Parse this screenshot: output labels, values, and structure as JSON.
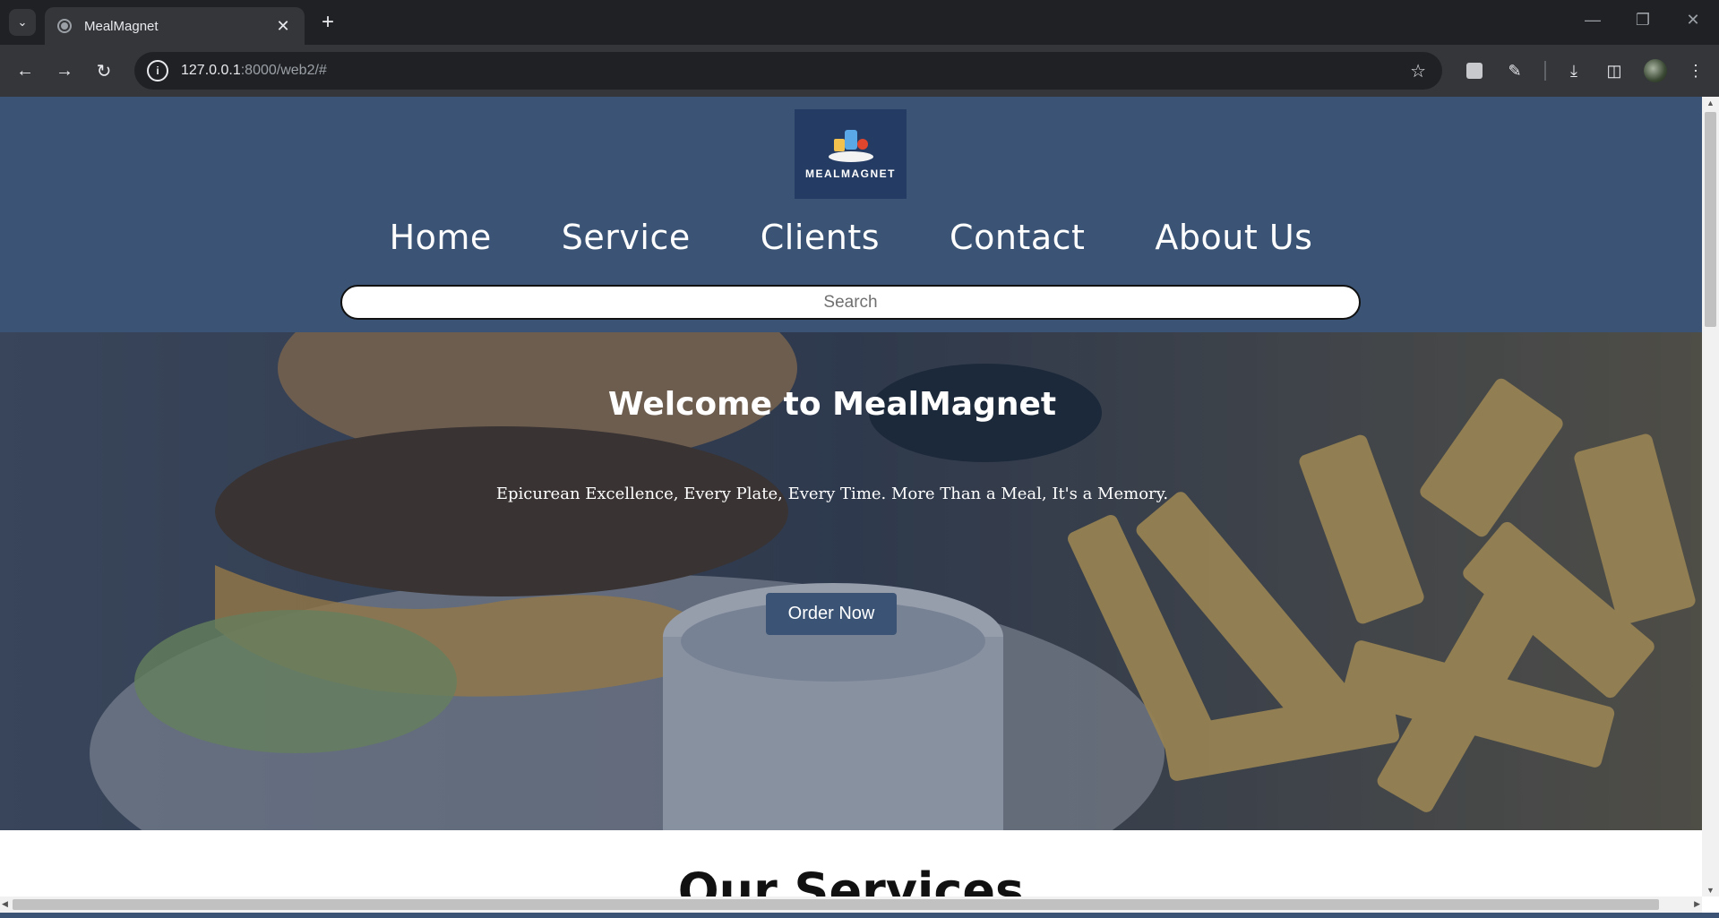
{
  "browser": {
    "tab_title": "MealMagnet",
    "url_host": "127.0.0.1",
    "url_path": ":8000/web2/#",
    "icons": [
      "tab-search-icon",
      "favicon-icon",
      "close-icon",
      "new-tab-icon",
      "back-icon",
      "forward-icon",
      "reload-icon",
      "site-info-icon",
      "star-icon",
      "extension-icon",
      "puzzle-icon",
      "download-icon",
      "sidebar-icon",
      "profile-avatar",
      "menu-icon"
    ]
  },
  "header": {
    "logo_text": "MEALMAGNET",
    "nav": [
      "Home",
      "Service",
      "Clients",
      "Contact",
      "About Us"
    ],
    "search_placeholder": "Search"
  },
  "hero": {
    "title": "Welcome to MealMagnet",
    "subtitle": "Epicurean Excellence, Every Plate, Every Time. More Than a Meal, It's a Memory.",
    "button": "Order Now"
  },
  "services": {
    "heading": "Our Services"
  },
  "colors": {
    "header_bg": "#3b5475",
    "button_bg": "#3b5475",
    "logo_bg": "#243b63",
    "chrome_dark": "#202124",
    "chrome_toolbar": "#35363a"
  }
}
